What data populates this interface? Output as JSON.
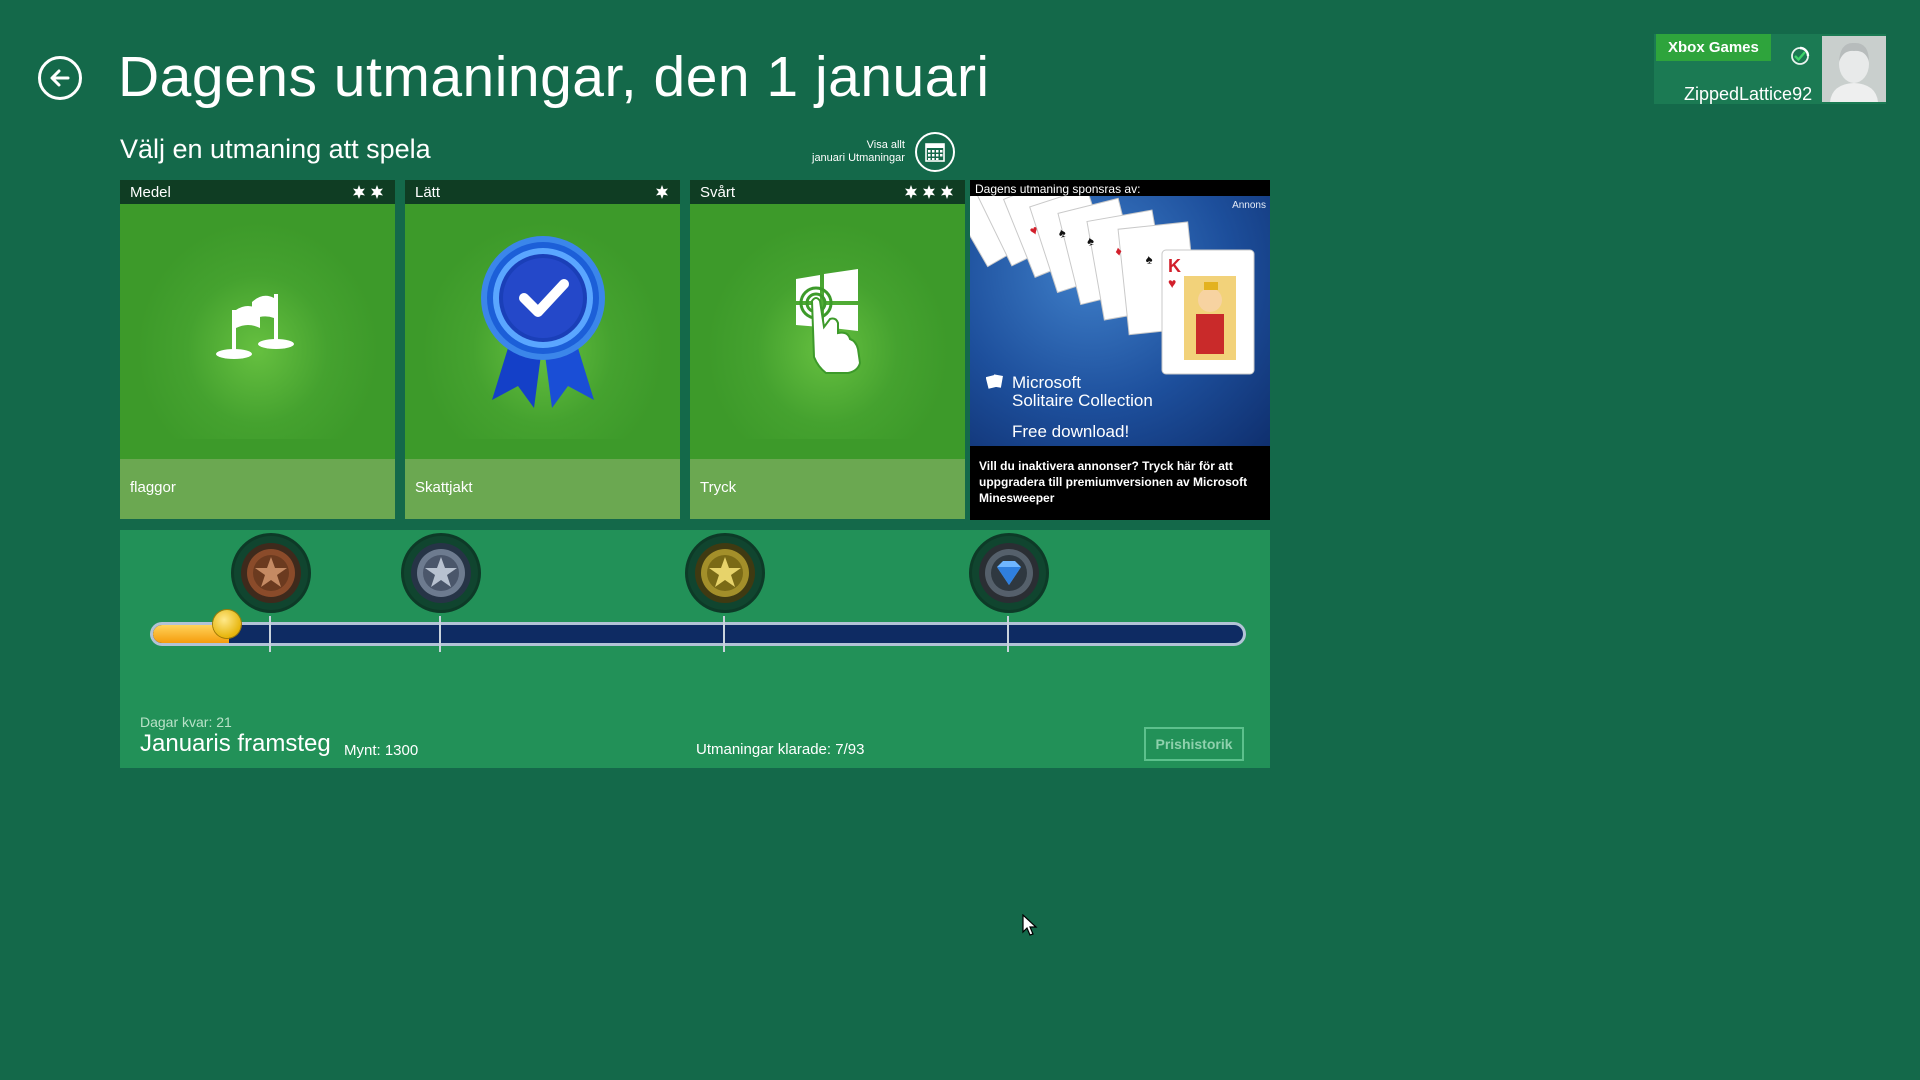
{
  "header": {
    "title": "Dagens utmaningar, den 1 januari",
    "subtitle": "Välj en utmaning att spela",
    "view_all": {
      "line1": "Visa allt",
      "line2": "januari Utmaningar"
    }
  },
  "account": {
    "badge": "Xbox Games",
    "gamertag": "ZippedLattice92"
  },
  "challenges": [
    {
      "difficulty": "Medel",
      "stars": 2,
      "name": "flaggor",
      "icon": "flag-icon"
    },
    {
      "difficulty": "Lätt",
      "stars": 1,
      "name": "Skattjakt",
      "icon": "ribbon-check-icon",
      "completed": true
    },
    {
      "difficulty": "Svårt",
      "stars": 3,
      "name": "Tryck",
      "icon": "tap-icon"
    }
  ],
  "ad": {
    "header": "Dagens utmaning sponsras av:",
    "label": "Annons",
    "brand_line1": "Microsoft",
    "brand_line2": "Solitaire Collection",
    "cta": "Free download!",
    "footer": "Vill du inaktivera annonser? Tryck här för att uppgradera till premiumversionen av Microsoft Minesweeper"
  },
  "progress": {
    "days_left": "Dagar kvar:  21",
    "month_title": "Januaris framsteg",
    "coins": "Mynt: 1300",
    "completed": "Utmaningar klarade: 7/93",
    "price_history_button": "Prishistorik",
    "fill_fraction": 0.07,
    "medals": [
      "bronze-medal-icon",
      "silver-medal-icon",
      "gold-medal-icon",
      "diamond-medal-icon"
    ]
  },
  "colors": {
    "background": "#14694a",
    "tile_green": "#3d9a2a",
    "panel": "#229158",
    "xbox_green": "#2ea43c"
  }
}
